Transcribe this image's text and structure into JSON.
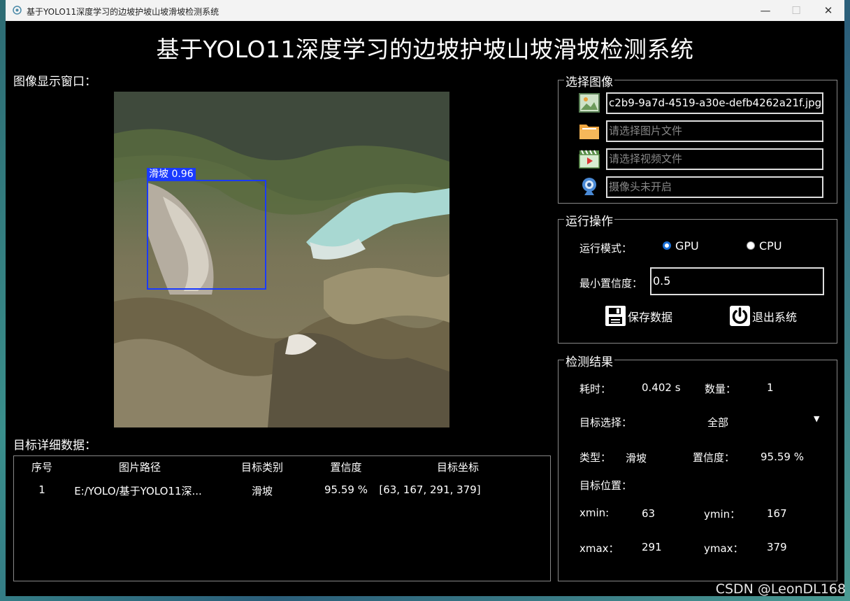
{
  "window": {
    "title": "基于YOLO11深度学习的边坡护坡山坡滑坡检测系统",
    "minimize": "—",
    "maximize": "☐",
    "close": "✕"
  },
  "header": {
    "title": "基于YOLO11深度学习的边坡护坡山坡滑坡检测系统"
  },
  "image_panel": {
    "label": "图像显示窗口：",
    "detection": {
      "label": "滑坡 0.96"
    }
  },
  "detail_table": {
    "label": "目标详细数据：",
    "columns": [
      "序号",
      "图片路径",
      "目标类别",
      "置信度",
      "目标坐标"
    ],
    "rows": [
      [
        "1",
        "E:/YOLO/基于YOLO11深...",
        "滑坡",
        "95.59 %",
        "[63, 167, 291, 379]"
      ]
    ]
  },
  "select_image": {
    "title": "选择图像",
    "image_file": "c2b9-9a7d-4519-a30e-defb4262a21f.jpg",
    "folder_placeholder": "请选择图片文件",
    "video_placeholder": "请选择视频文件",
    "camera_placeholder": "摄像头未开启"
  },
  "run_ops": {
    "title": "运行操作",
    "mode_label": "运行模式：",
    "gpu_label": "GPU",
    "cpu_label": "CPU",
    "selected_mode": "GPU",
    "conf_label": "最小置信度：",
    "conf_value": "0.5",
    "save_label": "保存数据",
    "exit_label": "退出系统"
  },
  "results": {
    "title": "检测结果",
    "time_label": "耗时：",
    "time_value": "0.402 s",
    "count_label": "数量：",
    "count_value": "1",
    "target_select_label": "目标选择：",
    "target_select_value": "全部",
    "type_label": "类型：",
    "type_value": "滑坡",
    "conf_label": "置信度：",
    "conf_value": "95.59 %",
    "position_label": "目标位置：",
    "xmin_label": "xmin:",
    "xmin_value": "63",
    "ymin_label": "ymin：",
    "ymin_value": "167",
    "xmax_label": "xmax：",
    "xmax_value": "291",
    "ymax_label": "ymax：",
    "ymax_value": "379"
  },
  "watermark": "CSDN @LeonDL168",
  "colors": {
    "accent": "#1a3aff",
    "radio": "#1a6fd6",
    "background": "#000000"
  }
}
